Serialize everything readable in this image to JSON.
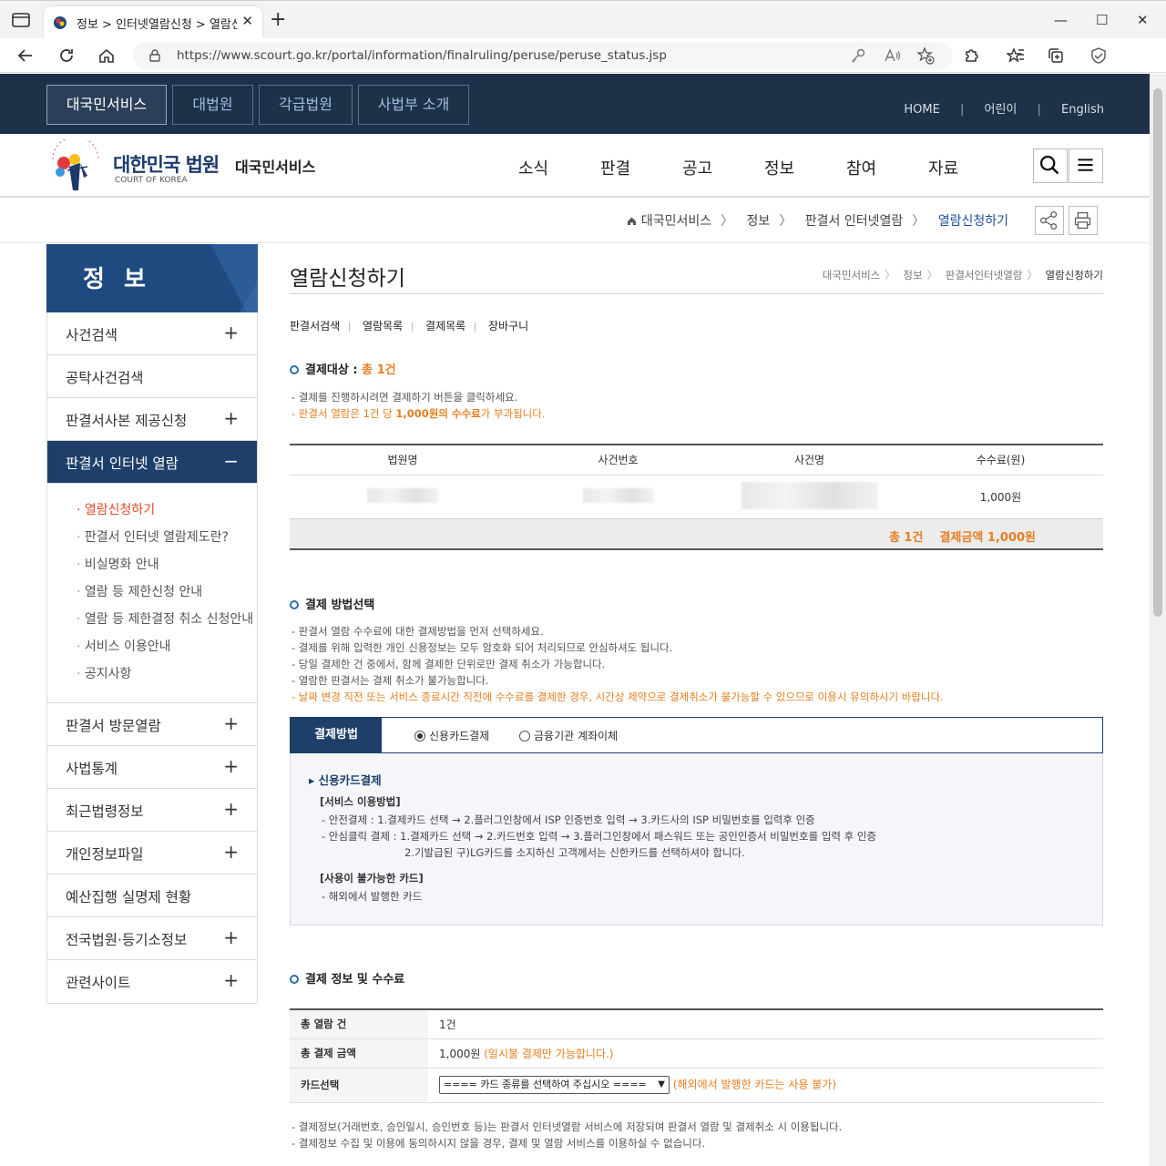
{
  "browser": {
    "tab_title": "정보 > 인터넷열람신청 > 열람신",
    "tab_close": "✕",
    "new_tab": "+",
    "url": "https://www.scourt.go.kr/portal/information/finalruling/peruse/peruse_status.jsp",
    "window_controls": [
      "—",
      "☐",
      "✕"
    ]
  },
  "topnav": {
    "buttons": [
      "대국민서비스",
      "대법원",
      "각급법원",
      "사법부 소개"
    ],
    "links": [
      "HOME",
      "어린이",
      "English"
    ],
    "separator": "|"
  },
  "gnb": {
    "logo_main": "대한민국 법원",
    "logo_sub": "COURT OF KOREA",
    "logo_service": "대국민서비스",
    "menu": [
      "소식",
      "판결",
      "공고",
      "정보",
      "참여",
      "자료"
    ]
  },
  "breadcrumb": {
    "items": [
      "대국민서비스",
      "정보",
      "판결서 인터넷열람",
      "열람신청하기"
    ],
    "arrow": "〉"
  },
  "lnb": {
    "title": "정 보",
    "items_top": [
      {
        "label": "사건검색",
        "pm": "+"
      },
      {
        "label": "공탁사건검색",
        "pm": ""
      },
      {
        "label": "판결서사본 제공신청",
        "pm": "+"
      },
      {
        "label": "판결서 인터넷 열람",
        "pm": "−"
      }
    ],
    "sub_items": [
      "열람신청하기",
      "판결서 인터넷 열람제도란?",
      "비실명화 안내",
      "열람 등 제한신청 안내",
      "열람 등 제한결정 취소 신청안내",
      "서비스 이용안내",
      "공지사항"
    ],
    "items_bottom": [
      {
        "label": "판결서 방문열람",
        "pm": "+"
      },
      {
        "label": "사법통계",
        "pm": "+"
      },
      {
        "label": "최근법령정보",
        "pm": "+"
      },
      {
        "label": "개인정보파일",
        "pm": "+"
      },
      {
        "label": "예산집행 실명제 현황",
        "pm": ""
      },
      {
        "label": "전국법원·등기소정보",
        "pm": "+"
      },
      {
        "label": "관련사이트",
        "pm": "+"
      }
    ]
  },
  "page": {
    "title": "열람신청하기",
    "mini_breadcrumb": [
      "대국민서비스",
      "정보",
      "판결서인터넷열람",
      "열람신청하기"
    ],
    "mini_arrow": "〉",
    "subtabs": [
      "판결서검색",
      "열람목록",
      "결제목록",
      "장바구니"
    ]
  },
  "section1": {
    "heading": "결제대상 : ",
    "count": "총 1건",
    "desc1": "- 결제를 진행하시려면 결제하기 버튼을 클릭하세요.",
    "desc2_pre": "- 판결서 열람은 1건 당 ",
    "desc2_bold": "1,000원의 수수료",
    "desc2_post": "가 부과됩니다.",
    "columns": [
      "법원명",
      "사건번호",
      "사건명",
      "수수료(원)"
    ],
    "row_fee": "1,000원",
    "sum_count": "총 1건",
    "sum_amount": "결제금액 1,000원"
  },
  "section2": {
    "heading": "결제 방법선택",
    "lines": [
      "- 판결서 열람 수수료에 대한 결제방법을 먼저 선택하세요.",
      "- 결제를 위해 입력한 개인 신용정보는 모두 암호화 되어 처리되므로 안심하셔도 됩니다.",
      "- 당일 결제한 건 중에서, 함께 결제한 단위로만 결제 취소가 가능합니다.",
      "- 열람한 판결서는 결제 취소가 불가능합니다."
    ],
    "warn": "- 날짜 변경 직전 또는 서비스 종료시간 직전에 수수료를 결제한 경우, 시간상 제약으로 결제취소가 불가능할 수 있으므로 이용시 유의하시기 바랍니다.",
    "pay_label": "결제방법",
    "radio_card": "신용카드결제",
    "radio_bank": "금융기관 계좌이체",
    "card_heading": "▸ 신용카드결제",
    "usage_title": "[서비스 이용방법]",
    "usage1": "- 안전결제 :    1.결제카드 선택 → 2.플러그인창에서 ISP 인증번호 입력 → 3.카드사의 ISP 비밀번호를 입력후 인증",
    "usage2": "- 안심클릭 결제 :   1.결제카드 선택 → 2.카드번호 입력 → 3.플러그인창에서 패스워드 또는 공인인증서 비밀번호를 입력 후 인증",
    "usage3": "2.기발급된 구)LG카드를 소지하신 고객께서는 신한카드를 선택하셔야 합니다.",
    "unusable_title": "[사용이 불가능한 카드]",
    "unusable1": "- 해외에서 발행한 카드"
  },
  "section3": {
    "heading": "결제 정보 및 수수료",
    "rows": [
      {
        "label": "총 열람 건",
        "value": "1건",
        "note": ""
      },
      {
        "label": "총 결제 금액",
        "value": "1,000원",
        "note": "(일시불 결제만 가능합니다.)"
      },
      {
        "label": "카드선택",
        "value": "==== 카드 종류를 선택하여 주십시오 ====",
        "note": "(해외에서 발행한 카드는 사용 불가)"
      }
    ],
    "foot1": "- 결제정보(거래번호, 승인일시, 승인번호 등)는 판결서 인터넷열람 서비스에 저장되며 판결서 열람 및 결제취소 시 이용됩니다.",
    "foot2": "- 결제정보 수집 및 이용에 동의하시지 않을 경우, 결제 및 열람 서비스를 이용하실 수 없습니다."
  },
  "colors": {
    "navy": "#1d3148",
    "accent_blue": "#1e4a80",
    "orange": "#e67e22",
    "active_red": "#e04b2a"
  }
}
